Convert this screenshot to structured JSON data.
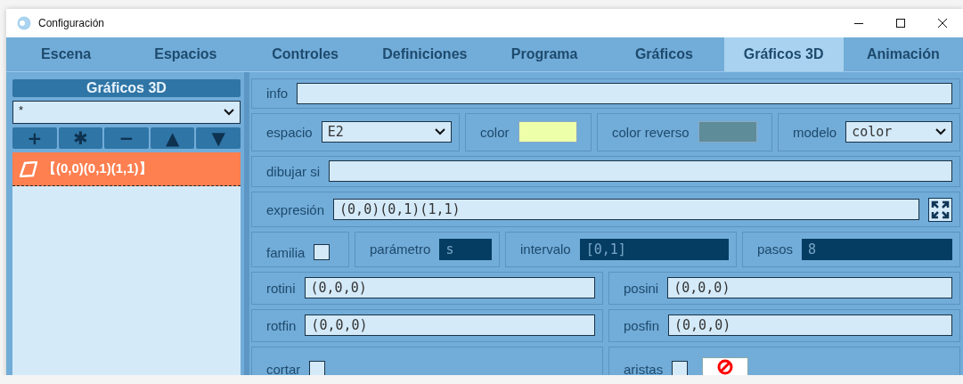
{
  "window": {
    "title": "Configuración"
  },
  "tabs": [
    {
      "label": "Escena",
      "selected": false
    },
    {
      "label": "Espacios",
      "selected": false
    },
    {
      "label": "Controles",
      "selected": false
    },
    {
      "label": "Definiciones",
      "selected": false
    },
    {
      "label": "Programa",
      "selected": false
    },
    {
      "label": "Gráficos",
      "selected": false
    },
    {
      "label": "Gráficos 3D",
      "selected": true
    },
    {
      "label": "Animación",
      "selected": false
    }
  ],
  "sidebar": {
    "title": "Gráficos 3D",
    "filter": "*",
    "buttons": [
      "+",
      "✱",
      "−",
      "▲",
      "▼"
    ],
    "items": [
      {
        "label": "【(0,0)(0,1)(1,1)】",
        "selected": true
      }
    ]
  },
  "form": {
    "rows": [
      [
        {
          "kind": "text",
          "label": "info"
        }
      ],
      [
        {
          "kind": "select",
          "label": "espacio",
          "value": "E2"
        },
        {
          "kind": "color",
          "label": "color",
          "color": "#eeffaa"
        },
        {
          "kind": "color",
          "label": "color reverso",
          "color": "#5f8c99"
        },
        {
          "kind": "select",
          "label": "modelo",
          "value": "color"
        }
      ],
      [
        {
          "kind": "text",
          "label": "dibujar si"
        }
      ],
      [
        {
          "kind": "text",
          "label": "expresión",
          "value": "(0,0)(0,1)(1,1)",
          "expand": true
        }
      ],
      [
        {
          "kind": "checkbox",
          "label": "familia",
          "checked": false
        },
        {
          "kind": "text",
          "label": "parámetro",
          "value": "s",
          "disabled": true
        },
        {
          "kind": "text",
          "label": "intervalo",
          "value": "[0,1]",
          "disabled": true
        },
        {
          "kind": "text",
          "label": "pasos",
          "value": "8",
          "disabled": true
        }
      ],
      [
        {
          "kind": "text",
          "label": "rotini",
          "value": "(0,0,0)"
        },
        {
          "kind": "text",
          "label": "posini",
          "value": "(0,0,0)"
        }
      ],
      [
        {
          "kind": "text",
          "label": "rotfin",
          "value": "(0,0,0)"
        },
        {
          "kind": "text",
          "label": "posfin",
          "value": "(0,0,0)"
        }
      ],
      [
        {
          "kind": "checkbox",
          "label": "cortar",
          "checked": false
        },
        {
          "kind": "checkbox",
          "label": "aristas",
          "checked": false,
          "no_color": true
        }
      ]
    ]
  }
}
